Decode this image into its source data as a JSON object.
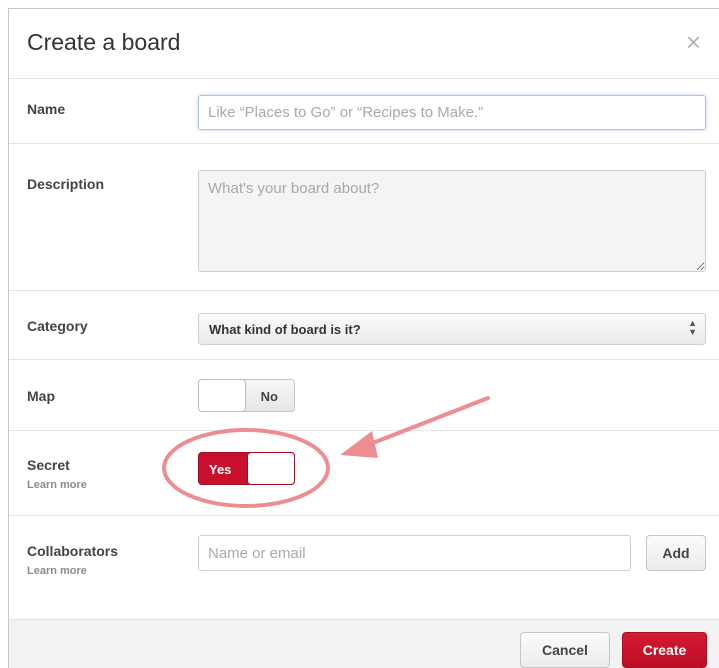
{
  "dialog": {
    "title": "Create a board",
    "close_glyph": "×"
  },
  "form": {
    "name": {
      "label": "Name",
      "placeholder": "Like “Places to Go” or “Recipes to Make.”",
      "value": ""
    },
    "description": {
      "label": "Description",
      "placeholder": "What's your board about?",
      "value": ""
    },
    "category": {
      "label": "Category",
      "selected": "What kind of board is it?"
    },
    "map": {
      "label": "Map",
      "toggle_text": "No",
      "state": "off"
    },
    "secret": {
      "label": "Secret",
      "sublabel": "Learn more",
      "toggle_text": "Yes",
      "state": "on"
    },
    "collaborators": {
      "label": "Collaborators",
      "sublabel": "Learn more",
      "placeholder": "Name or email",
      "value": "",
      "add_label": "Add"
    }
  },
  "footer": {
    "cancel_label": "Cancel",
    "create_label": "Create"
  },
  "colors": {
    "accent_red": "#c8102e",
    "focus_blue": "#a7c7ea",
    "annotation_pink": "#ec8d92"
  },
  "icons": {
    "close": "close-icon",
    "select_arrows": "updown-arrows-icon"
  }
}
